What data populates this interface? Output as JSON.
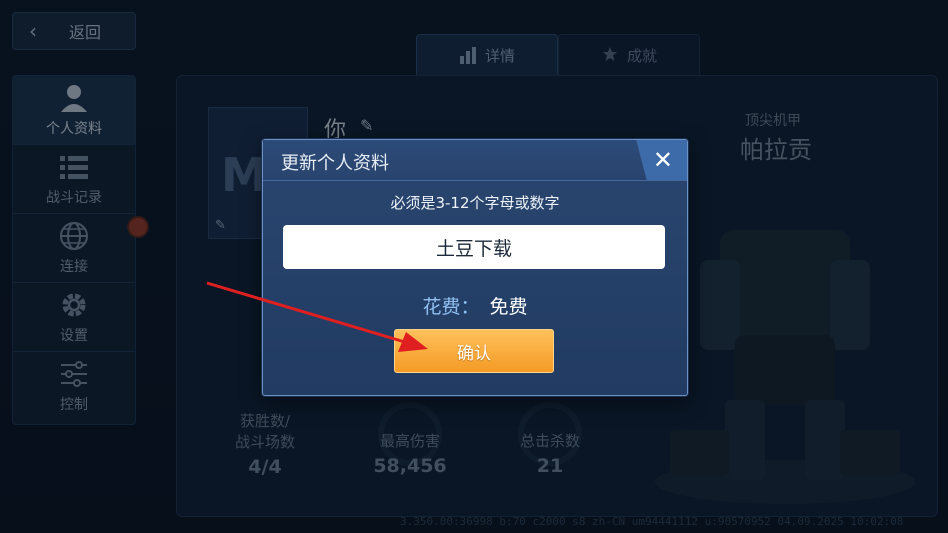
{
  "nav": {
    "back_label": "返回"
  },
  "sidebar": {
    "items": [
      {
        "label": "个人资料",
        "icon": "person-icon",
        "active": true
      },
      {
        "label": "战斗记录",
        "icon": "list-icon",
        "active": false
      },
      {
        "label": "连接",
        "icon": "globe-icon",
        "active": false
      },
      {
        "label": "设置",
        "icon": "gear-icon",
        "active": false
      },
      {
        "label": "控制",
        "icon": "sliders-icon",
        "active": false
      }
    ]
  },
  "tabs": [
    {
      "label": "详情",
      "icon": "bar-chart-icon",
      "active": true
    },
    {
      "label": "成就",
      "icon": "badge-icon",
      "active": false
    }
  ],
  "profile": {
    "player_name": "你",
    "mech_caption": "顶尖机甲",
    "mech_name": "帕拉贡"
  },
  "stats": [
    {
      "label_line1": "获胜数/",
      "label_line2": "战斗场数",
      "value": "4/4"
    },
    {
      "label_line1": "",
      "label_line2": "最高伤害",
      "value": "58,456"
    },
    {
      "label_line1": "",
      "label_line2": "总击杀数",
      "value": "21"
    }
  ],
  "debug_info": "3.350.00:36998 b:70 c2000 s8 zh-CN um94441112 u:90570952 04.09.2025 10:02:08",
  "dialog": {
    "title": "更新个人资料",
    "hint": "必须是3-12个字母或数字",
    "input_value": "土豆下载",
    "cost_label": "花费：",
    "cost_value": "免费",
    "confirm_label": "确认"
  },
  "colors": {
    "confirm_button": "#f49b26",
    "dialog_bg": "#2a4670",
    "annotation_arrow": "#e02020"
  }
}
